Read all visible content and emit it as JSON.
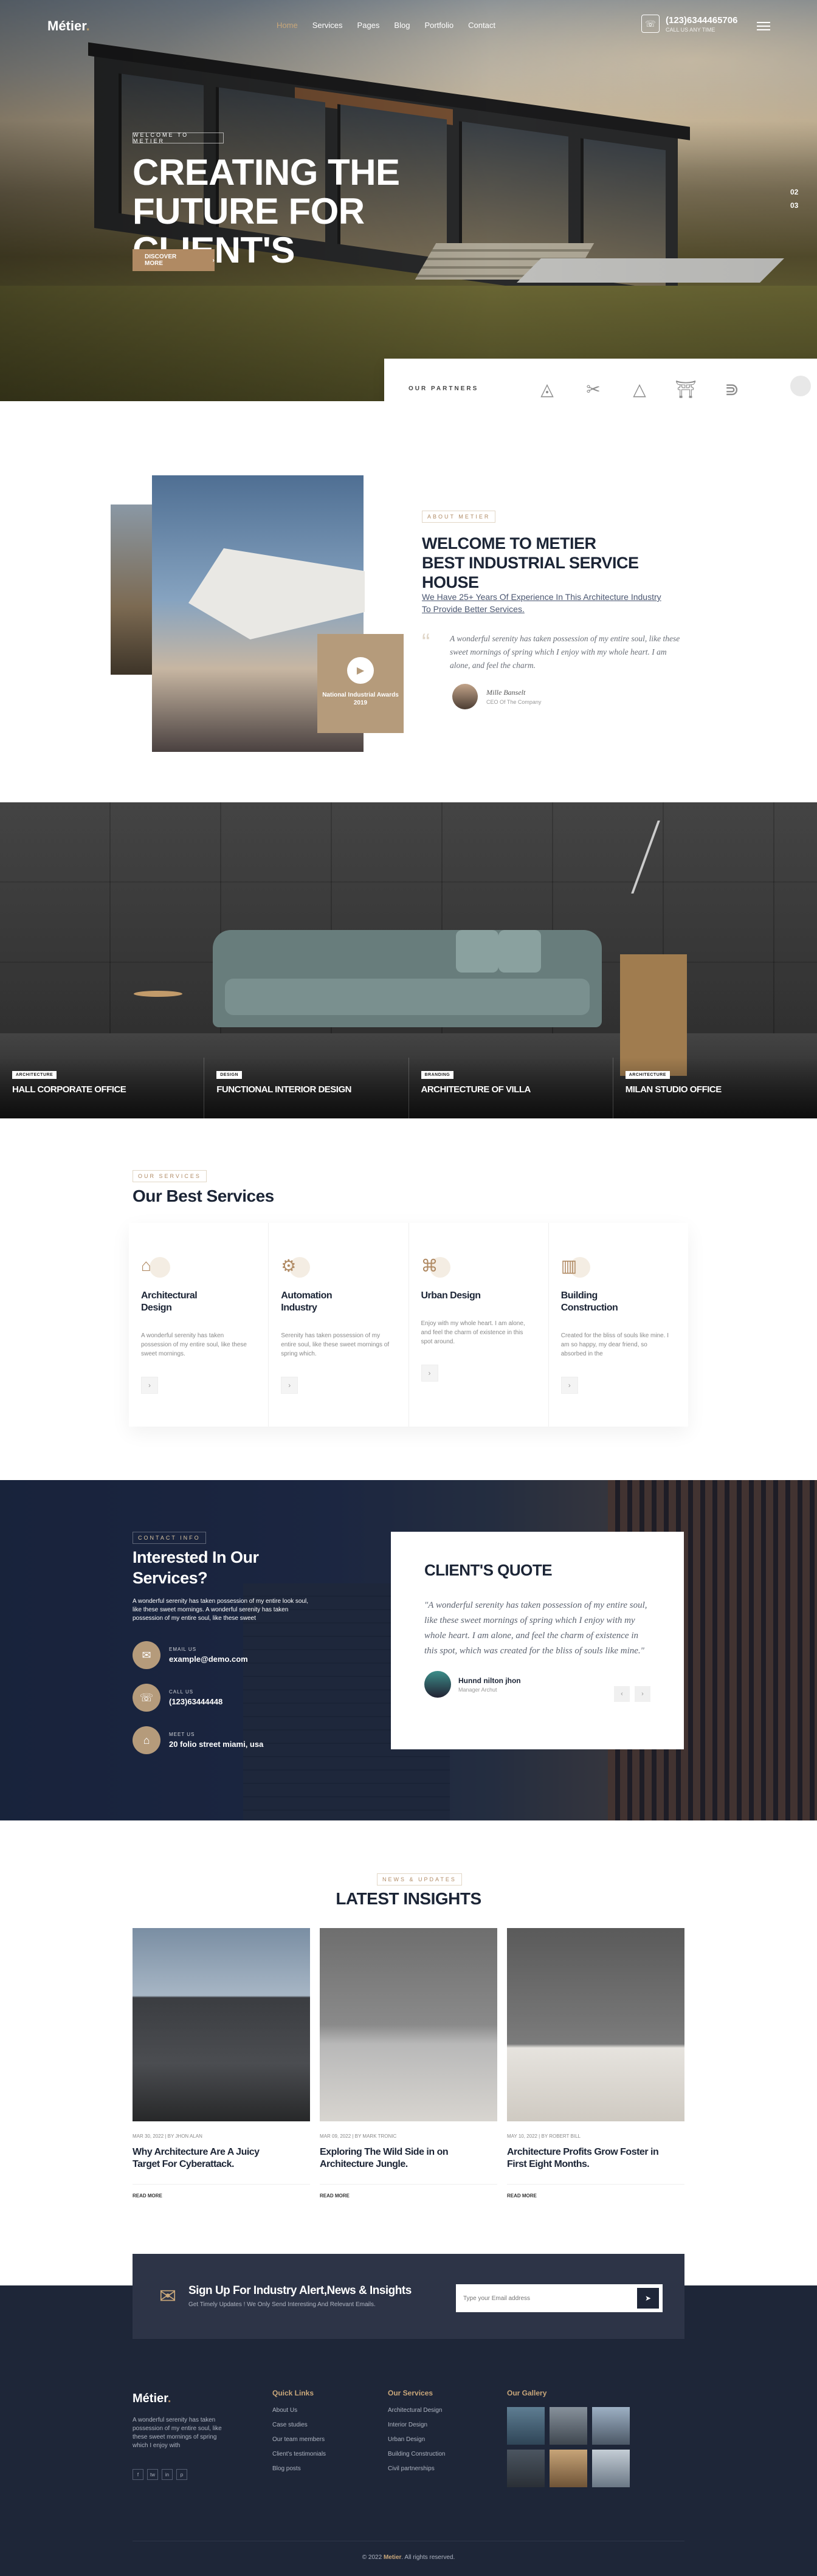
{
  "nav": {
    "logo_main": "Métier",
    "logo_dot": ".",
    "items": [
      "Home",
      "Services",
      "Pages",
      "Blog",
      "Portfolio",
      "Contact"
    ],
    "phone": "(123)6344465706",
    "phone_sub": "CALL US ANY TIME"
  },
  "hero": {
    "kicker": "WELCOME TO METIER",
    "title_line1": "CREATING THE",
    "title_line2": "FUTURE FOR CLIENT'S",
    "cta": "DISCOVER MORE",
    "pager_1": "02",
    "pager_2": "03"
  },
  "partners": {
    "label": "OUR PARTNERS",
    "logos": [
      "partner-logo-1",
      "partner-logo-2",
      "partner-logo-3",
      "partner-logo-4",
      "partner-logo-5"
    ]
  },
  "about": {
    "kicker": "ABOUT METIER",
    "title_line1": "WELCOME TO METIER",
    "title_line2": "BEST INDUSTRIAL SERVICE HOUSE",
    "lead": "We Have 25+ Years Of Experience In This Architecture Industry To Provide Better Services.",
    "quote": "A wonderful serenity has taken possession of my entire soul, like these sweet mornings of spring which I enjoy with my whole heart. I am alone, and feel the charm.",
    "signature": "Mille Banselt",
    "role": "CEO Of The Company",
    "award": "National Industrial Awards 2019"
  },
  "gallery": {
    "items": [
      {
        "tag": "ARCHITECTURE",
        "title": "HALL CORPORATE OFFICE"
      },
      {
        "tag": "DESIGN",
        "title": "FUNCTIONAL INTERIOR DESIGN"
      },
      {
        "tag": "BRANDING",
        "title": "ARCHITECTURE OF VILLA"
      },
      {
        "tag": "ARCHITECTURE",
        "title": "MILAN STUDIO OFFICE"
      }
    ]
  },
  "services": {
    "kicker": "OUR SERVICES",
    "title": "Our Best Services",
    "cards": [
      {
        "title": "Architectural Design",
        "text": "A wonderful serenity has taken possession of my entire soul, like these sweet mornings."
      },
      {
        "title": "Automation Industry",
        "text": "Serenity has taken possession of my entire soul, like these sweet mornings of spring which."
      },
      {
        "title": "Urban Design",
        "text": "Enjoy with my whole heart. I am alone, and feel the charm of existence in this spot around."
      },
      {
        "title": "Building Construction",
        "text": "Created for the bliss of souls like mine. I am so happy, my dear friend, so absorbed in the"
      }
    ]
  },
  "contact": {
    "kicker": "CONTACT INFO",
    "title": "Interested In Our Services?",
    "desc": "A wonderful serenity has taken possession of my entire look soul, like these sweet mornings. A wonderful serenity has taken possession of my entire soul, like these sweet",
    "items": [
      {
        "label": "EMAIL US",
        "value": "example@demo.com"
      },
      {
        "label": "CALL US",
        "value": "(123)63444448"
      },
      {
        "label": "MEET US",
        "value": "20 folio street miami, usa"
      }
    ],
    "quote_title": "CLIENT'S QUOTE",
    "quote": "\"A wonderful serenity has taken possession of my entire soul, like these sweet mornings of spring which I enjoy with my whole heart. I am alone, and feel the charm of existence in this spot, which was created for the bliss of souls like mine.\"",
    "author": "Hunnd nilton jhon",
    "author_role": "Manager Archut"
  },
  "insights": {
    "kicker": "NEWS & UPDATES",
    "title": "LATEST INSIGHTS",
    "posts": [
      {
        "meta": "MAR 30, 2022  |  BY JHON ALAN",
        "title": "Why Architecture Are A Juicy Target For Cyberattack.",
        "more": "READ MORE"
      },
      {
        "meta": "MAR 09, 2022  |  BY MARK TRONIC",
        "title": "Exploring The Wild Side in on Architecture Jungle.",
        "more": "READ MORE"
      },
      {
        "meta": "MAY 10, 2022  |  BY ROBERT BILL",
        "title": "Architecture Profits Grow Foster in First Eight Months.",
        "more": "READ MORE"
      }
    ]
  },
  "footer": {
    "sub_title": "Sign Up For Industry Alert,News & Insights",
    "sub_text": "Get Timely Updates ! We Only Send Interesting And Relevant Emails.",
    "sub_placeholder": "Type your Email address",
    "logo_main": "Métier",
    "logo_dot": ".",
    "desc": "A wonderful serenity has taken possession of my entire soul, like these sweet mornings of spring which I enjoy with",
    "social": [
      "f",
      "tw",
      "in",
      "p"
    ],
    "quick_title": "Quick Links",
    "quick": [
      "About Us",
      "Case studies",
      "Our team members",
      "Client's testimonials",
      "Blog posts"
    ],
    "services_title": "Our Services",
    "services": [
      "Architectural Design",
      "Interior Design",
      "Urban Design",
      "Building Construction",
      "Civil partnerships"
    ],
    "gallery_title": "Our Gallery",
    "copy_pre": "© 2022",
    "copy_brand": "Metier",
    "copy_post": ". All rights reserved."
  }
}
